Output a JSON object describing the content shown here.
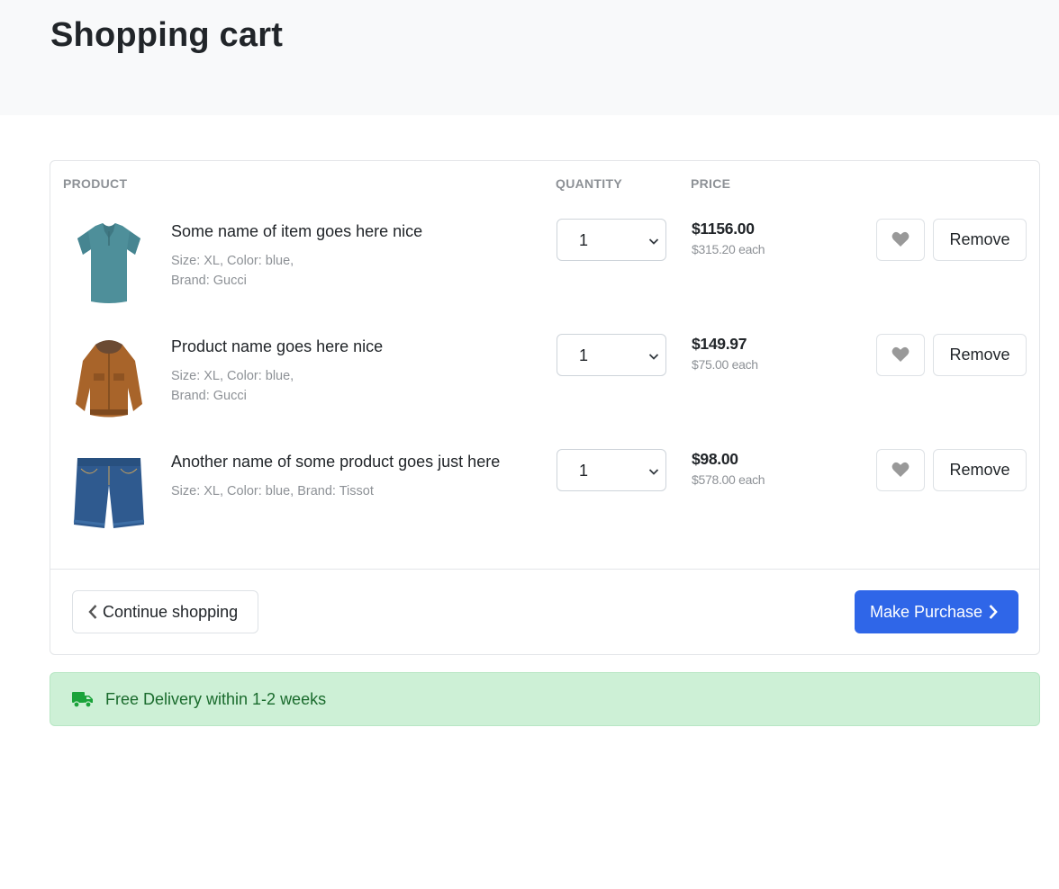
{
  "page": {
    "title": "Shopping cart"
  },
  "table": {
    "headers": {
      "product": "PRODUCT",
      "quantity": "QUANTITY",
      "price": "PRICE"
    }
  },
  "items": [
    {
      "name": "Some name of item goes here nice",
      "meta_line1": "Size: XL, Color: blue,",
      "meta_line2": "Brand: Gucci",
      "image": "teal-polo-shirt",
      "quantity": "1",
      "price": "$1156.00",
      "each": "$315.20 each",
      "remove_label": "Remove"
    },
    {
      "name": "Product name goes here nice",
      "meta_line1": "Size: XL, Color: blue,",
      "meta_line2": "Brand: Gucci",
      "image": "brown-winter-jacket",
      "quantity": "1",
      "price": "$149.97",
      "each": "$75.00 each",
      "remove_label": "Remove"
    },
    {
      "name": "Another name of some product goes just here",
      "meta_line1": "Size: XL, Color: blue, Brand: Tissot",
      "meta_line2": "",
      "image": "denim-shorts",
      "quantity": "1",
      "price": "$98.00",
      "each": "$578.00 each",
      "remove_label": "Remove"
    }
  ],
  "actions": {
    "continue_label": "Continue shopping",
    "purchase_label": "Make Purchase"
  },
  "delivery": {
    "text": "Free Delivery within 1-2 weeks",
    "icon": "truck-icon"
  },
  "colors": {
    "primary": "#2f66e8",
    "alert_bg": "#cdf0d6",
    "alert_text": "#1a6b2d",
    "muted": "#8d9196",
    "heart": "#999999"
  }
}
